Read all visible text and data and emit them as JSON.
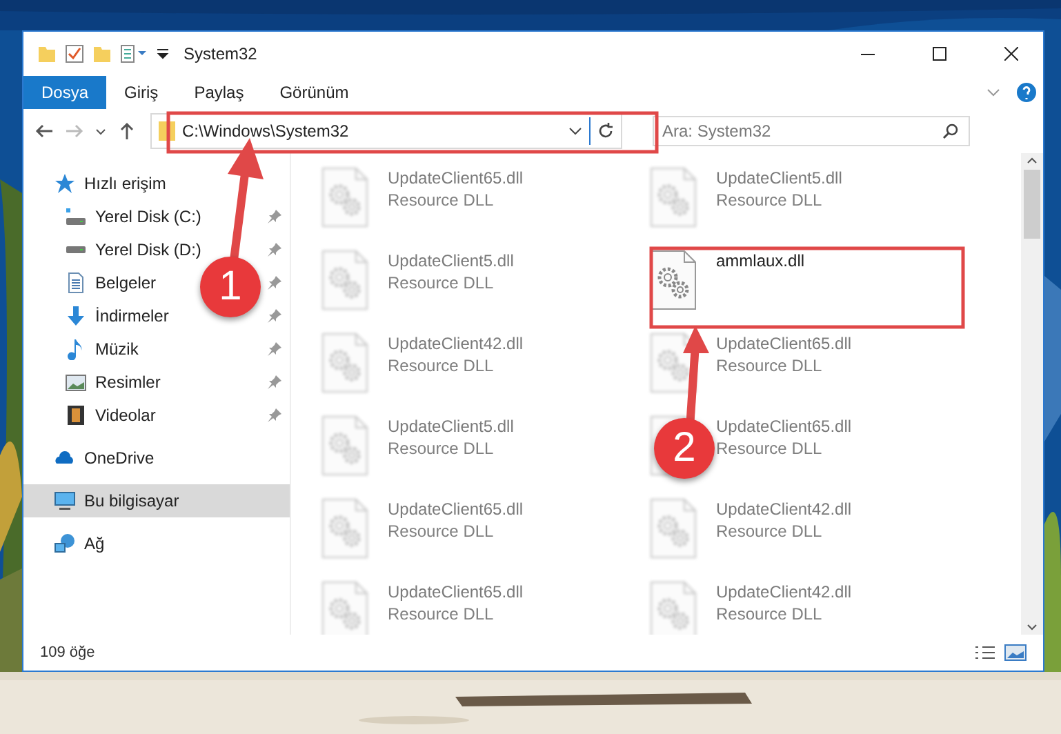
{
  "window": {
    "title": "System32"
  },
  "ribbon_tabs": [
    {
      "label": "Dosya",
      "selected": true
    },
    {
      "label": "Giriş",
      "selected": false
    },
    {
      "label": "Paylaş",
      "selected": false
    },
    {
      "label": "Görünüm",
      "selected": false
    }
  ],
  "address": {
    "path": "C:\\Windows\\System32"
  },
  "search": {
    "placeholder": "Ara: System32"
  },
  "sidebar": {
    "items": [
      {
        "label": "Hızlı erişim",
        "kind": "star",
        "selected": false,
        "children": [
          {
            "label": "Yerel Disk (C:)",
            "kind": "system-drive",
            "pinned": true,
            "selected": false
          },
          {
            "label": "Yerel Disk (D:)",
            "kind": "drive",
            "pinned": true,
            "selected": false
          },
          {
            "label": "Belgeler",
            "kind": "documents",
            "pinned": true,
            "selected": false
          },
          {
            "label": "İndirmeler",
            "kind": "downloads",
            "pinned": true,
            "selected": false
          },
          {
            "label": "Müzik",
            "kind": "music",
            "pinned": true,
            "selected": false
          },
          {
            "label": "Resimler",
            "kind": "pictures",
            "pinned": true,
            "selected": false
          },
          {
            "label": "Videolar",
            "kind": "videos",
            "pinned": true,
            "selected": false
          }
        ]
      },
      {
        "label": "OneDrive",
        "kind": "cloud",
        "selected": false
      },
      {
        "label": "Bu bilgisayar",
        "kind": "computer",
        "selected": true
      },
      {
        "label": "Ağ",
        "kind": "network",
        "selected": false
      }
    ]
  },
  "files": [
    {
      "name": "UpdateClient65.dll",
      "type": "Resource DLL",
      "kind": "blurred"
    },
    {
      "name": "UpdateClient5.dll",
      "type": "Resource DLL",
      "kind": "blurred"
    },
    {
      "name": "UpdateClient5.dll",
      "type": "Resource DLL",
      "kind": "blurred"
    },
    {
      "name": "ammlaux.dll",
      "kind": "clear"
    },
    {
      "name": "UpdateClient42.dll",
      "type": "Resource DLL",
      "kind": "blurred"
    },
    {
      "name": "UpdateClient65.dll",
      "type": "Resource DLL",
      "kind": "blurred"
    },
    {
      "name": "UpdateClient5.dll",
      "type": "Resource DLL",
      "kind": "blurred"
    },
    {
      "name": "UpdateClient65.dll",
      "type": "Resource DLL",
      "kind": "blurred"
    },
    {
      "name": "UpdateClient65.dll",
      "type": "Resource DLL",
      "kind": "blurred"
    },
    {
      "name": "UpdateClient42.dll",
      "type": "Resource DLL",
      "kind": "blurred"
    },
    {
      "name": "UpdateClient65.dll",
      "type": "Resource DLL",
      "kind": "blurred"
    },
    {
      "name": "UpdateClient42.dll",
      "type": "Resource DLL",
      "kind": "blurred"
    }
  ],
  "status_bar": {
    "count": "109 öğe"
  },
  "annotations": [
    {
      "number": "1"
    },
    {
      "number": "2"
    }
  ]
}
